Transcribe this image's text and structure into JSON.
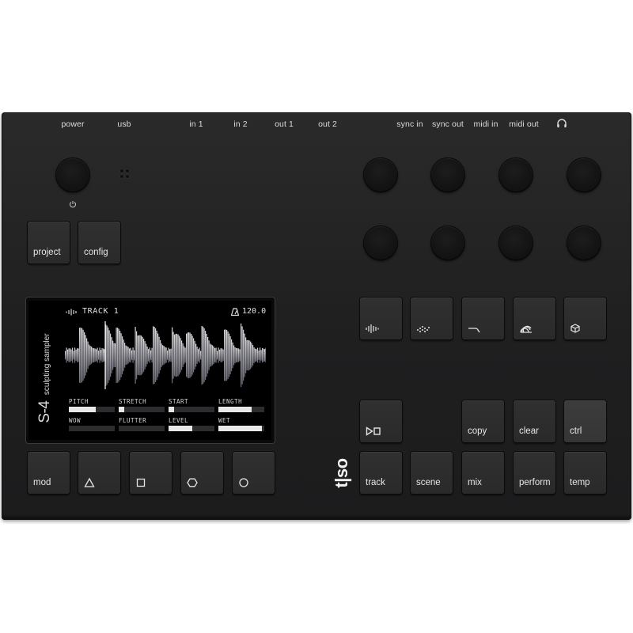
{
  "ports": {
    "power": "power",
    "usb": "usb",
    "in1": "in 1",
    "in2": "in 2",
    "out1": "out 1",
    "out2": "out 2",
    "sync_in": "sync in",
    "sync_out": "sync out",
    "midi_in": "midi in",
    "midi_out": "midi out"
  },
  "buttons": {
    "project": "project",
    "config": "config",
    "mod": "mod",
    "copy": "copy",
    "clear": "clear",
    "ctrl": "ctrl",
    "track": "track",
    "scene": "scene",
    "mix": "mix",
    "perform": "perform",
    "temp": "temp"
  },
  "screen": {
    "track_label": "TRACK 1",
    "tempo": "120.0",
    "device_name": "S-4",
    "device_subtitle": "sculpting sampler",
    "params": [
      {
        "label": "PITCH",
        "level": 0.58
      },
      {
        "label": "STRETCH",
        "level": 0.12
      },
      {
        "label": "START",
        "level": 0.12
      },
      {
        "label": "LENGTH",
        "level": 0.72
      },
      {
        "label": "WOW",
        "level": 0.0
      },
      {
        "label": "FLUTTER",
        "level": 0.0
      },
      {
        "label": "LEVEL",
        "level": 0.52
      },
      {
        "label": "WET",
        "level": 0.95
      }
    ]
  },
  "brand": "t|so",
  "icons": {
    "headphones": "headphones-icon",
    "power": "power-icon",
    "shapes": [
      "triangle-icon",
      "square-icon",
      "hexagon-icon",
      "circle-icon"
    ],
    "play_stop": "play-stop-icon"
  }
}
